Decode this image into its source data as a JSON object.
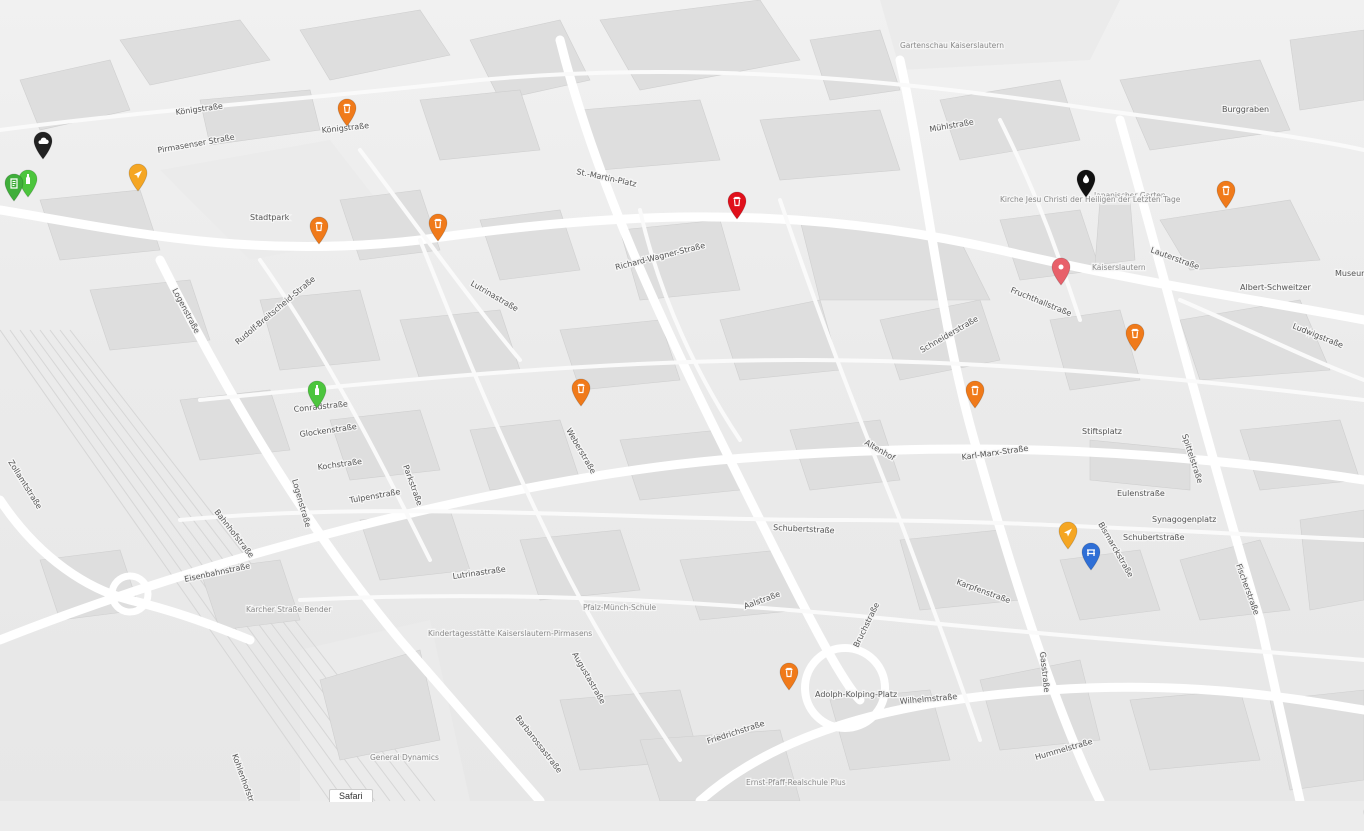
{
  "map": {
    "badge": "Safari",
    "streets": [
      {
        "text": "Königstraße"
      },
      {
        "text": "Königstraße"
      },
      {
        "text": "Pirmasenser Straße"
      },
      {
        "text": "Stadtpark"
      },
      {
        "text": "Logenstraße"
      },
      {
        "text": "Rudolf-Breitscheid-Straße"
      },
      {
        "text": "Conradstraße"
      },
      {
        "text": "Glockenstraße"
      },
      {
        "text": "Kochstraße"
      },
      {
        "text": "Tulpenstraße"
      },
      {
        "text": "Parkstraße"
      },
      {
        "text": "Logenstraße"
      },
      {
        "text": "Bahnhofstraße"
      },
      {
        "text": "Eisenbahnstraße"
      },
      {
        "text": "Zollamtstraße"
      },
      {
        "text": "Barbarossastraße"
      },
      {
        "text": "Augustastraße"
      },
      {
        "text": "Lutrinastraße"
      },
      {
        "text": "Aalstraße"
      },
      {
        "text": "Friedrichstraße"
      },
      {
        "text": "Adolph-Kolping-Platz"
      },
      {
        "text": "Wilhelmstraße"
      },
      {
        "text": "Hummelstraße"
      },
      {
        "text": "Karl-Marx-Straße"
      },
      {
        "text": "Schubertstraße"
      },
      {
        "text": "Schubertstraße"
      },
      {
        "text": "Synagogenplatz"
      },
      {
        "text": "Bismarckstraße"
      },
      {
        "text": "Fischerstraße"
      },
      {
        "text": "Gasstraße"
      },
      {
        "text": "Spittelstraße"
      },
      {
        "text": "Stiftsplatz"
      },
      {
        "text": "Eulenstraße"
      },
      {
        "text": "Fruchthallstraße"
      },
      {
        "text": "Schneiderstraße"
      },
      {
        "text": "Lauterstraße"
      },
      {
        "text": "Ludwigstraße"
      },
      {
        "text": "Burggraben"
      },
      {
        "text": "Mühlstraße"
      },
      {
        "text": "Bruchstraße"
      },
      {
        "text": "Karpfenstraße"
      },
      {
        "text": "Weberstraße"
      },
      {
        "text": "Richard-Wagner-Straße"
      },
      {
        "text": "Kohlenhofstraße"
      },
      {
        "text": "Albert-Schweitzer"
      },
      {
        "text": "Museum"
      },
      {
        "text": "St.-Martin-Platz"
      },
      {
        "text": "Lutrinastraße"
      },
      {
        "text": "Altenhof"
      }
    ],
    "pois": [
      {
        "text": "Kindertagesstätte Kaiserslautern-Pirmasens"
      },
      {
        "text": "Pfalz-Münch-Schule"
      },
      {
        "text": "Ernst-Pfaff-Realschule Plus"
      },
      {
        "text": "Japanischer Garten"
      },
      {
        "text": "Gartenschau Kaiserslautern"
      },
      {
        "text": "General Dynamics"
      },
      {
        "text": "Karcher Straße Bender"
      },
      {
        "text": "Kirche Jesu Christi der Heiligen der Letzten Tage"
      },
      {
        "text": "Kaiserslautern"
      }
    ],
    "markers": [
      {
        "kind": "waste-bin",
        "color": "#f07a1a"
      },
      {
        "kind": "waste-bin",
        "color": "#f07a1a"
      },
      {
        "kind": "waste-bin",
        "color": "#f07a1a"
      },
      {
        "kind": "waste-bin",
        "color": "#e0101b"
      },
      {
        "kind": "waste-bin",
        "color": "#f07a1a"
      },
      {
        "kind": "waste-bin",
        "color": "#f07a1a"
      },
      {
        "kind": "waste-bin",
        "color": "#f07a1a"
      },
      {
        "kind": "waste-bin",
        "color": "#f07a1a"
      },
      {
        "kind": "waste-bin",
        "color": "#f07a1a"
      },
      {
        "kind": "waste-bin",
        "color": "#f07a1a"
      },
      {
        "kind": "navigation-arrow",
        "color": "#f5a623"
      },
      {
        "kind": "navigation-arrow",
        "color": "#f5a623"
      },
      {
        "kind": "location-pin",
        "color": "#e8606a"
      },
      {
        "kind": "bench",
        "color": "#2f6fd6"
      },
      {
        "kind": "drop",
        "color": "#111111"
      },
      {
        "kind": "cloud",
        "color": "#222222"
      },
      {
        "kind": "bottle",
        "color": "#4cc53d"
      },
      {
        "kind": "bottle",
        "color": "#4cc53d"
      },
      {
        "kind": "document",
        "color": "#3fae3a"
      }
    ]
  }
}
